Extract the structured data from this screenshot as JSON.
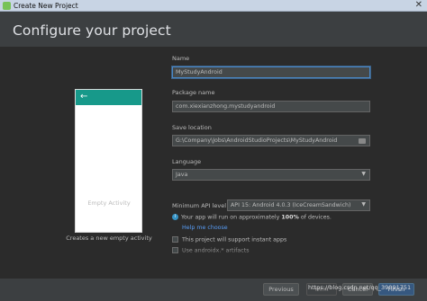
{
  "window": {
    "title": "Create New Project"
  },
  "header": {
    "title": "Configure your project"
  },
  "template": {
    "name": "Empty Activity",
    "description": "Creates a new empty activity"
  },
  "form": {
    "name": {
      "label": "Name",
      "value": "MyStudyAndroid"
    },
    "package": {
      "label": "Package name",
      "value": "com.xiexianzhong.mystudyandroid"
    },
    "save_location": {
      "label": "Save location",
      "value": "G:\\Company\\Jobs\\AndroidStudioProjects\\MyStudyAndroid"
    },
    "language": {
      "label": "Language",
      "value": "Java"
    },
    "min_api": {
      "label": "Minimum API level",
      "value": "API 15: Android 4.0.3 (IceCreamSandwich)"
    },
    "info_text_pre": "Your app will run on approximately",
    "info_percent": "100%",
    "info_text_post": "of devices.",
    "help_link": "Help me choose",
    "instant_apps_label": "This project will support instant apps",
    "androidx_label": "Use androidx.* artifacts"
  },
  "footer": {
    "previous_label": "Previous",
    "next_label": "Next",
    "cancel_label": "Cancel",
    "finish_label": "Finish"
  },
  "watermark": "https://blog.csdn.net/qq_39091751",
  "colors": {
    "accent_bar": "#17998a",
    "focus_border": "#4a88c7",
    "link": "#589df6",
    "primary_button": "#365880"
  },
  "icons": {
    "app": "android-studio-icon",
    "back": "arrow-left-icon",
    "info": "info-icon",
    "folder": "folder-icon"
  }
}
